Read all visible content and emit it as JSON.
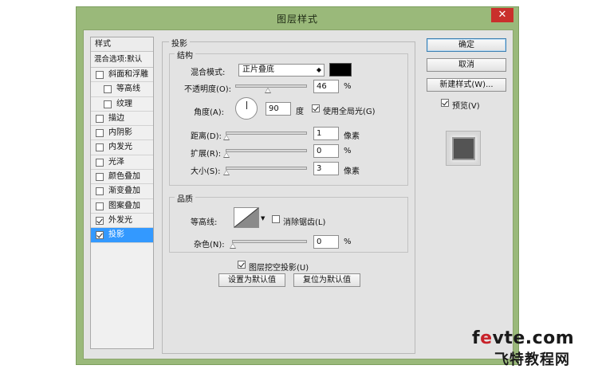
{
  "window": {
    "title": "图层样式",
    "close_glyph": "✕"
  },
  "sidebar": {
    "header": "样式",
    "blend_options": "混合选项:默认",
    "items": [
      {
        "label": "斜面和浮雕",
        "checked": false,
        "indent": false,
        "selected": false
      },
      {
        "label": "等高线",
        "checked": false,
        "indent": true,
        "selected": false
      },
      {
        "label": "纹理",
        "checked": false,
        "indent": true,
        "selected": false
      },
      {
        "label": "描边",
        "checked": false,
        "indent": false,
        "selected": false
      },
      {
        "label": "内阴影",
        "checked": false,
        "indent": false,
        "selected": false
      },
      {
        "label": "内发光",
        "checked": false,
        "indent": false,
        "selected": false
      },
      {
        "label": "光泽",
        "checked": false,
        "indent": false,
        "selected": false
      },
      {
        "label": "颜色叠加",
        "checked": false,
        "indent": false,
        "selected": false
      },
      {
        "label": "渐变叠加",
        "checked": false,
        "indent": false,
        "selected": false
      },
      {
        "label": "图案叠加",
        "checked": false,
        "indent": false,
        "selected": false
      },
      {
        "label": "外发光",
        "checked": true,
        "indent": false,
        "selected": false
      },
      {
        "label": "投影",
        "checked": true,
        "indent": false,
        "selected": true
      }
    ]
  },
  "drop_shadow": {
    "group_title": "投影",
    "structure": {
      "title": "结构",
      "blend_mode_label": "混合模式:",
      "blend_mode_value": "正片叠底",
      "shadow_color": "#000000",
      "opacity_label": "不透明度(O):",
      "opacity_value": "46",
      "opacity_fraction": 0.46,
      "opacity_unit": "%",
      "angle_label": "角度(A):",
      "angle_value": "90",
      "angle_unit": "度",
      "global_light_label": "使用全局光(G)",
      "global_light_checked": true,
      "distance_label": "距离(D):",
      "distance_value": "1",
      "distance_fraction": 0.0,
      "distance_unit": "像素",
      "spread_label": "扩展(R):",
      "spread_value": "0",
      "spread_fraction": 0.0,
      "spread_unit": "%",
      "size_label": "大小(S):",
      "size_value": "3",
      "size_fraction": 0.0,
      "size_unit": "像素"
    },
    "quality": {
      "title": "品质",
      "contour_label": "等高线:",
      "anti_alias_label": "消除锯齿(L)",
      "anti_alias_checked": false,
      "noise_label": "杂色(N):",
      "noise_value": "0",
      "noise_fraction": 0.0,
      "noise_unit": "%"
    },
    "knockout_label": "图层挖空投影(U)",
    "knockout_checked": true,
    "make_default_label": "设置为默认值",
    "reset_default_label": "复位为默认值"
  },
  "buttons": {
    "ok": "确定",
    "cancel": "取消",
    "new_style": "新建样式(W)...",
    "preview_label": "预览(V)",
    "preview_checked": true
  },
  "watermark": {
    "line1_prefix": "f",
    "line1_accent": "e",
    "line1_suffix": "vte.com",
    "line2": "飞特教程网"
  }
}
